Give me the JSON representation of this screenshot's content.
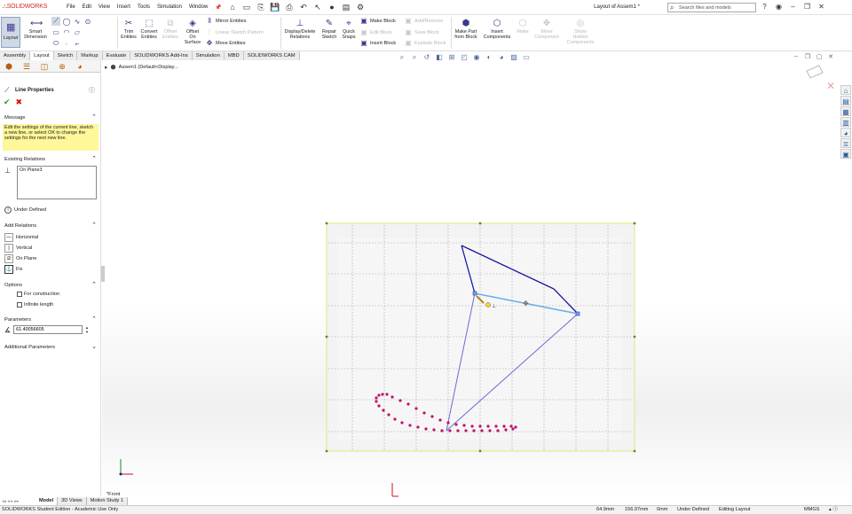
{
  "titlebar": {
    "logo_brand": "SOLID",
    "logo_rest": "WORKS",
    "menus": [
      "File",
      "Edit",
      "View",
      "Insert",
      "Tools",
      "Simulation",
      "Window"
    ],
    "pin_icon": "pin-icon",
    "document_title": "Layout of Assem1 *",
    "search_placeholder": "Search files and models"
  },
  "ribbon": {
    "layout_label": "Layout",
    "smart_dimension": "Smart\nDimension",
    "trim_entities": "Trim\nEntities",
    "convert_entities": "Convert\nEntities",
    "offset_entities": "Offset\nEntities",
    "offset_on_surface": "Offset\nOn\nSurface",
    "mirror_entities": "Mirror Entities",
    "linear_sketch_pattern": "Linear Sketch Pattern",
    "move_entities": "Move Entities",
    "display_delete_relations": "Display/Delete\nRelations",
    "repair_sketch": "Repair\nSketch",
    "quick_snaps": "Quick\nSnaps",
    "make_block": "Make Block",
    "edit_block": "Edit Block",
    "insert_block": "Insert Block",
    "add_remove": "Add/Remove",
    "save_block": "Save Block",
    "explode_block": "Explode Block",
    "make_part_from_block": "Make Part\nfrom Block",
    "insert_components": "Insert\nComponents",
    "make": "Make",
    "move_component": "Move\nComponent",
    "show_hidden_components": "Show\nHidden\nComponents"
  },
  "command_tabs": [
    "Assembly",
    "Layout",
    "Sketch",
    "Markup",
    "Evaluate",
    "SOLIDWORKS Add-Ins",
    "Simulation",
    "MBD",
    "SOLIDWORKS CAM"
  ],
  "active_command_tab": "Layout",
  "property_manager": {
    "title": "Line Properties",
    "message_header": "Message",
    "message_text": "Edit the settings of the current line, sketch a new line, or select OK to change the settings for the next new line.",
    "existing_relations_header": "Existing Relations",
    "existing_relations": [
      "On Plane3"
    ],
    "status": "Under Defined",
    "add_relations_header": "Add Relations",
    "add_relations": [
      "Horizontal",
      "Vertical",
      "On Plane",
      "Fix"
    ],
    "options_header": "Options",
    "options": [
      "For construction",
      "Infinite length"
    ],
    "parameters_header": "Parameters",
    "angle_value": "61.40056605",
    "additional_parameters_header": "Additional Parameters"
  },
  "feature_tree": {
    "root": "Assem1 (Default<Display..."
  },
  "viewport": {
    "view_name": "*Front"
  },
  "bottom_tabs": [
    "Model",
    "3D Views",
    "Motion Study 1"
  ],
  "active_bottom_tab": "Model",
  "status_bar": {
    "edition": "SOLIDWORKS Student Edition - Academic Use Only",
    "x": "64.9mm",
    "y": "156.97mm",
    "z": "0mm",
    "definition": "Under Defined",
    "mode": "Editing Layout",
    "units": "MMGS"
  },
  "colors": {
    "brand_red": "#d52b1e",
    "sketch_blue": "#1a1aa0",
    "selected_line": "#6ab0e8",
    "path_magenta": "#c0106a",
    "message_yellow": "#fff79a",
    "selection_box": "#f0f090"
  }
}
